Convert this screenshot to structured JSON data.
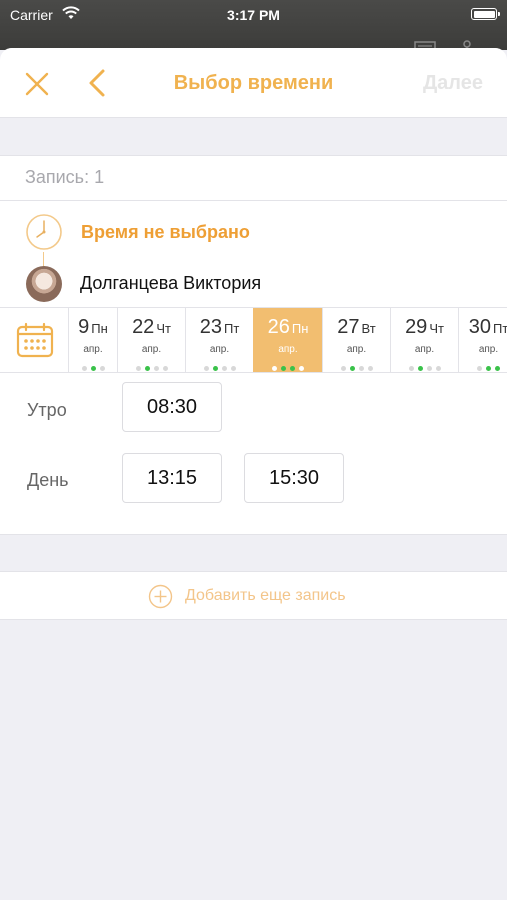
{
  "status_bar": {
    "carrier": "Carrier",
    "time": "3:17 PM"
  },
  "nav": {
    "title": "Выбор времени",
    "next_label": "Далее"
  },
  "record": {
    "label": "Запись: 1",
    "time_status": "Время не выбрано",
    "master_name": "Долганцева Виктория"
  },
  "dates": [
    {
      "day": "9",
      "weekday": "Пн",
      "month": "апр.",
      "dots": [
        0,
        1,
        0
      ],
      "selected": false
    },
    {
      "day": "22",
      "weekday": "Чт",
      "month": "апр.",
      "dots": [
        0,
        1,
        0,
        0
      ],
      "selected": false
    },
    {
      "day": "23",
      "weekday": "Пт",
      "month": "апр.",
      "dots": [
        0,
        1,
        0,
        0
      ],
      "selected": false
    },
    {
      "day": "26",
      "weekday": "Пн",
      "month": "апр.",
      "dots": [
        0,
        1,
        1,
        0
      ],
      "selected": true
    },
    {
      "day": "27",
      "weekday": "Вт",
      "month": "апр.",
      "dots": [
        0,
        1,
        0,
        0
      ],
      "selected": false
    },
    {
      "day": "29",
      "weekday": "Чт",
      "month": "апр.",
      "dots": [
        0,
        1,
        0,
        0
      ],
      "selected": false
    },
    {
      "day": "30",
      "weekday": "Пт",
      "month": "апр.",
      "dots": [
        0,
        1,
        1
      ],
      "selected": false
    }
  ],
  "slots": {
    "morning_label": "Утро",
    "morning": [
      "08:30"
    ],
    "day_label": "День",
    "day": [
      "13:15",
      "15:30"
    ]
  },
  "add_record_label": "Добавить еще запись",
  "colors": {
    "accent": "#f0b24f",
    "accent_selected": "#f2be70",
    "available_dot": "#3ac24a"
  }
}
